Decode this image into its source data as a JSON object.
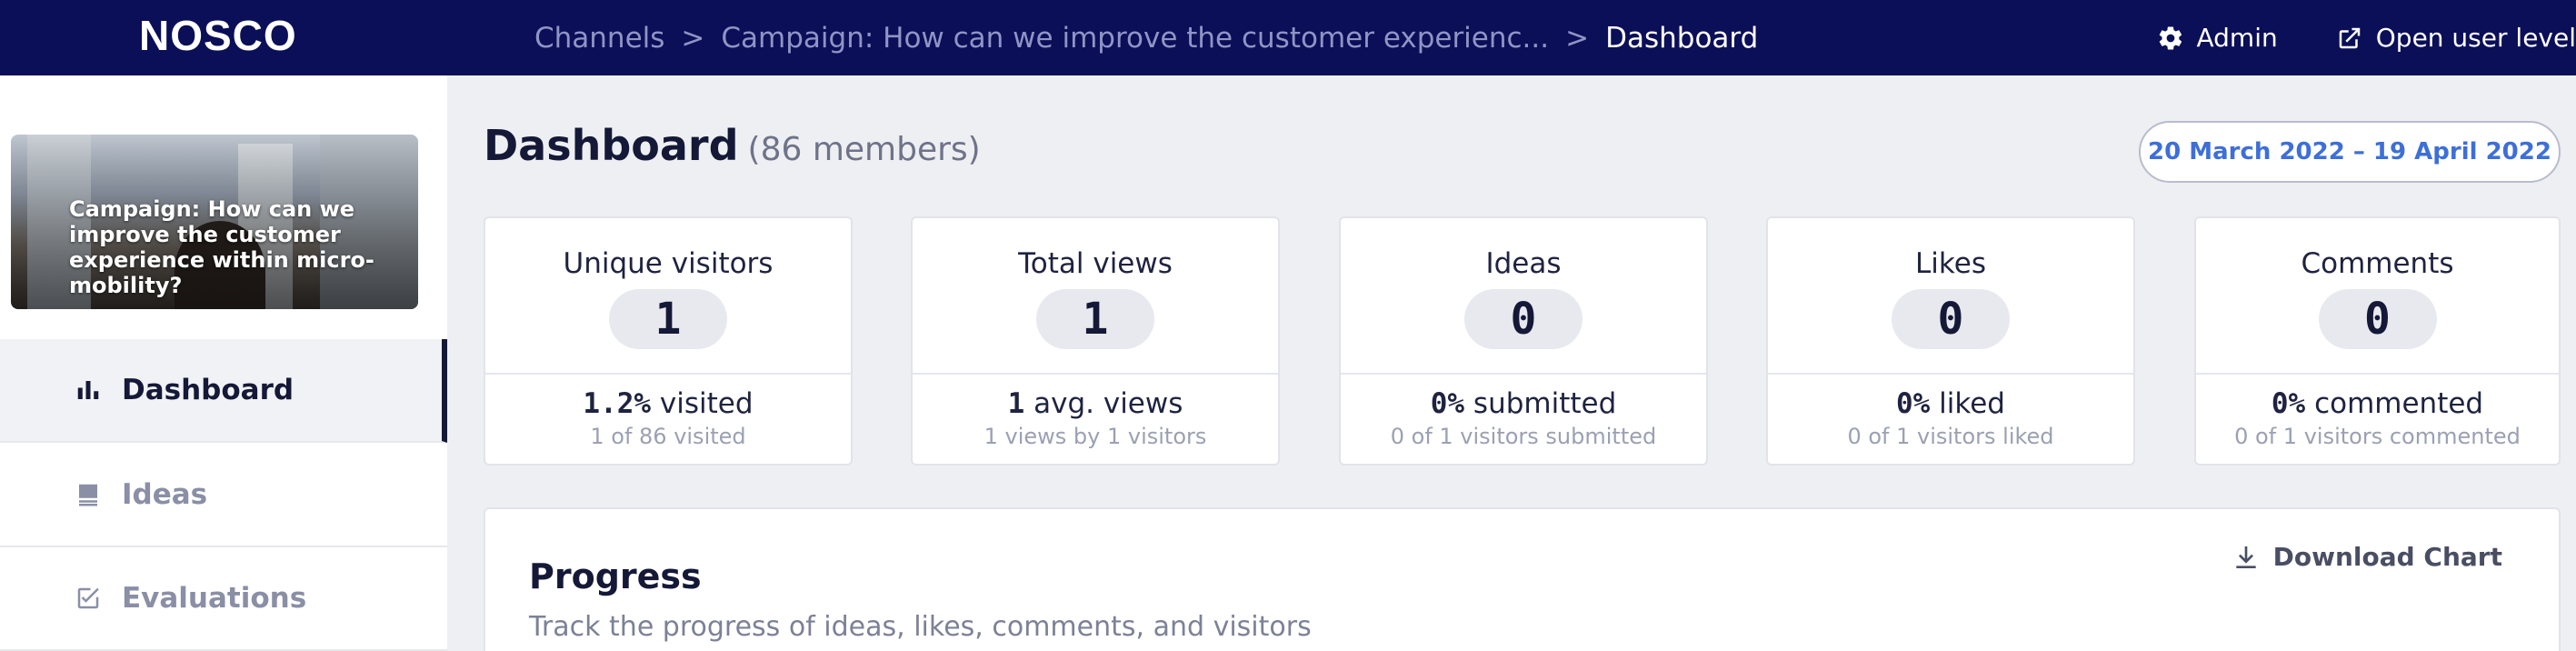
{
  "header": {
    "logo": "NOSCO",
    "breadcrumbs": {
      "channels": "Channels",
      "separator": ">",
      "campaign": "Campaign: How can we improve the customer experienc...",
      "current": "Dashboard"
    },
    "admin_label": "Admin",
    "open_user_level_label": "Open user level"
  },
  "sidebar": {
    "campaign_card_title": "Campaign: How can we improve the customer experience within micro-mobility?",
    "items": [
      {
        "label": "Dashboard",
        "icon": "bar-chart-icon",
        "active": true
      },
      {
        "label": "Ideas",
        "icon": "ideas-icon",
        "active": false
      },
      {
        "label": "Evaluations",
        "icon": "checkbox-icon",
        "active": false
      }
    ]
  },
  "main": {
    "title": "Dashboard",
    "members": "(86 members)",
    "date_range": "20 March 2022 – 19 April 2022",
    "stats": [
      {
        "label": "Unique visitors",
        "value": "1",
        "main_num": "1.2%",
        "main_text": " visited",
        "sub": "1 of 86 visited"
      },
      {
        "label": "Total views",
        "value": "1",
        "main_num": "1",
        "main_text": " avg. views",
        "sub": "1 views by 1 visitors"
      },
      {
        "label": "Ideas",
        "value": "0",
        "main_num": "0%",
        "main_text": " submitted",
        "sub": "0 of 1 visitors submitted"
      },
      {
        "label": "Likes",
        "value": "0",
        "main_num": "0%",
        "main_text": " liked",
        "sub": "0 of 1 visitors liked"
      },
      {
        "label": "Comments",
        "value": "0",
        "main_num": "0%",
        "main_text": " commented",
        "sub": "0 of 1 visitors commented"
      }
    ],
    "progress": {
      "title": "Progress",
      "subtitle": "Track the progress of ideas, likes, comments, and visitors",
      "download_label": "Download Chart"
    }
  },
  "colors": {
    "topbar": "#0b0f58",
    "accent": "#3e6fd8",
    "background": "#eeeff3"
  }
}
